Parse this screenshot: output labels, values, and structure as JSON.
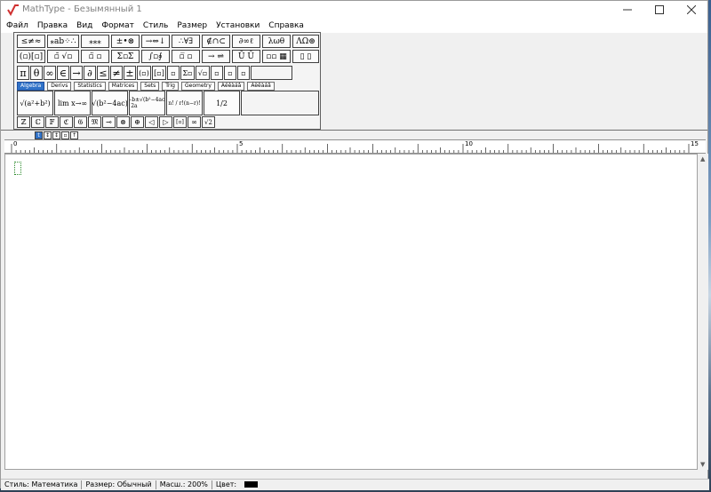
{
  "window": {
    "title": "MathType - Безымянный 1"
  },
  "menu": [
    "Файл",
    "Правка",
    "Вид",
    "Формат",
    "Стиль",
    "Размер",
    "Установки",
    "Справка"
  ],
  "palette": {
    "row1": [
      "≤≠≈",
      "⁎ab⁘∴",
      "⁎⁎⁎",
      "±•⊗",
      "→⇔↓",
      "∴∀∃",
      "∉∩⊂",
      "∂∞ℓ",
      "λωθ",
      "ΛΩ⊛"
    ],
    "row2": [
      "(▫)[▫]",
      "▫̄ √▫",
      "▫̈ ▫",
      "Σ▫Σ",
      "∫▫∮",
      "▫̅ ▫",
      "→ ⇌",
      "Ū Ŭ",
      "▫▫ ▦",
      "▯ ▯"
    ],
    "symbols": [
      "π",
      "θ",
      "∞",
      "∈",
      "→",
      "∂",
      "≤",
      "≠",
      "±",
      "(▫)",
      "[▫]",
      "▫",
      "Σ▫",
      "√▫",
      "▫",
      "▫",
      "▫"
    ],
    "tabs": [
      "Algebra",
      "Derivs",
      "Statistics",
      "Matrices",
      "Sets",
      "Trig",
      "Geometry",
      "Àëêàáâ",
      "Àëêàáâ"
    ],
    "templates": [
      "√(a²+b²)",
      "lim x→∞",
      "√(b²−4ac)",
      "−b±√(b²−4ac) / 2a",
      "n! / r!(n−r)!",
      "1/2"
    ],
    "bottom": [
      "ℤ",
      "ℂ",
      "𝔽",
      "ℭ",
      "𝔊",
      "𝔐",
      "⊸",
      "⊗",
      "⊕",
      "◁",
      "▷",
      "[▫]",
      "∞",
      "√2"
    ]
  },
  "sizes": [
    "t",
    "↕",
    "↕",
    "▫",
    "↑"
  ],
  "ruler": {
    "labels": [
      "0",
      "5",
      "10",
      "15"
    ]
  },
  "status": {
    "style": "Стиль: Математика",
    "size": "Размер: Обычный",
    "zoom": "Масш.: 200%",
    "color_label": "Цвет:",
    "color": "#000000"
  },
  "colors": {
    "accent": "#3072c8",
    "icon_red": "#d03030"
  }
}
